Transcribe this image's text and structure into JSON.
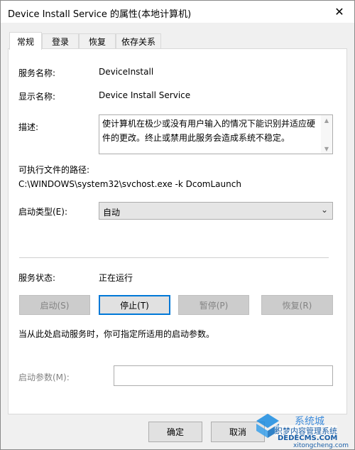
{
  "window": {
    "title": "Device Install Service 的属性(本地计算机)",
    "close_glyph": "✕"
  },
  "tabs": [
    {
      "label": "常规",
      "active": true
    },
    {
      "label": "登录",
      "active": false
    },
    {
      "label": "恢复",
      "active": false
    },
    {
      "label": "依存关系",
      "active": false
    }
  ],
  "general": {
    "service_name_label": "服务名称:",
    "service_name_value": "DeviceInstall",
    "display_name_label": "显示名称:",
    "display_name_value": "Device Install Service",
    "description_label": "描述:",
    "description_value": "使计算机在极少或没有用户输入的情况下能识别并适应硬件的更改。终止或禁用此服务会造成系统不稳定。",
    "path_label": "可执行文件的路径:",
    "path_value": "C:\\WINDOWS\\system32\\svchost.exe -k DcomLaunch",
    "startup_type_label": "启动类型(E):",
    "startup_type_value": "自动",
    "status_label": "服务状态:",
    "status_value": "正在运行",
    "start_button": "启动(S)",
    "stop_button": "停止(T)",
    "pause_button": "暂停(P)",
    "resume_button": "恢复(R)",
    "hint_text": "当从此处启动服务时，你可指定所适用的启动参数。",
    "start_params_label": "启动参数(M):",
    "start_params_value": ""
  },
  "footer": {
    "ok_button": "确定",
    "cancel_button": "取消"
  },
  "watermark": {
    "line1": "系统城",
    "line2": "织梦内容管理系统",
    "line3": "DEDECMS.COM",
    "line4": "xitongcheng.com"
  },
  "colors": {
    "accent": "#0078d7",
    "panel_bg": "#ffffff",
    "window_bg": "#f0f0f0"
  }
}
